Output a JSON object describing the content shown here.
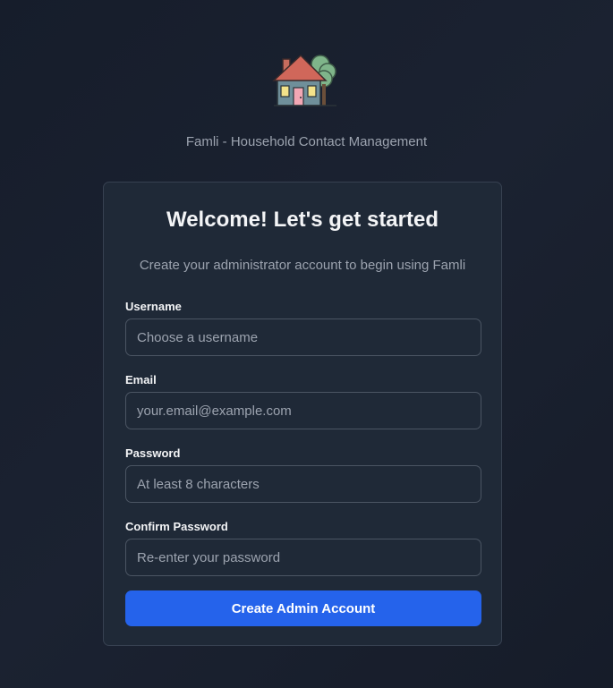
{
  "app": {
    "subtitle": "Famli - Household Contact Management",
    "logo_icon": "house-icon"
  },
  "card": {
    "title": "Welcome! Let's get started",
    "description": "Create your administrator account to begin using Famli"
  },
  "form": {
    "fields": [
      {
        "label": "Username",
        "placeholder": "Choose a username",
        "value": ""
      },
      {
        "label": "Email",
        "placeholder": "your.email@example.com",
        "value": ""
      },
      {
        "label": "Password",
        "placeholder": "At least 8 characters",
        "value": ""
      },
      {
        "label": "Confirm Password",
        "placeholder": "Re-enter your password",
        "value": ""
      }
    ],
    "submit_label": "Create Admin Account"
  },
  "colors": {
    "background": "#1b2231",
    "card": "#1f2937",
    "primary": "#2563eb",
    "roof": "#d0675a",
    "wall": "#6f8f9a",
    "tree": "#7fb58a",
    "window": "#f3e38a",
    "door": "#f2a7b4"
  }
}
